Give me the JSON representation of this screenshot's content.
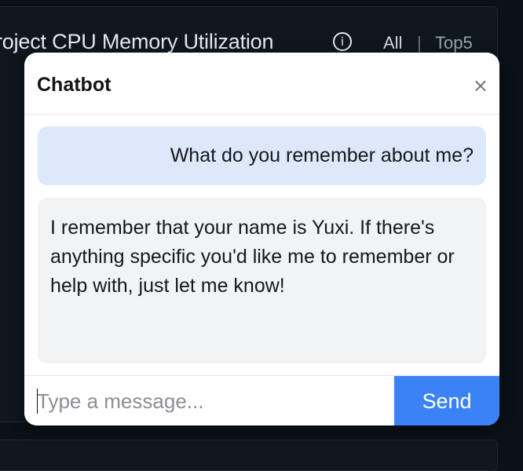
{
  "background": {
    "title_prefix": "roject",
    "title_rest": "CPU Memory Utilization",
    "info_icon": "info-circle-icon",
    "info_glyph": "i",
    "filter_all": "All",
    "filter_separator": "|",
    "filter_top5": "Top5"
  },
  "chatbot": {
    "title": "Chatbot",
    "close_label": "×",
    "messages": [
      {
        "role": "user",
        "text": "What do you remember about me?"
      },
      {
        "role": "assistant",
        "text": "I remember that your name is Yuxi. If there's anything specific you'd like me to remember or help with, just let me know!"
      }
    ],
    "input": {
      "value": "",
      "placeholder": "Type a message..."
    },
    "send_label": "Send"
  },
  "colors": {
    "accent": "#3b82f6",
    "user_bubble": "#dde9fb",
    "assistant_bubble": "#f2f3f5",
    "page_background": "#0b1118"
  }
}
